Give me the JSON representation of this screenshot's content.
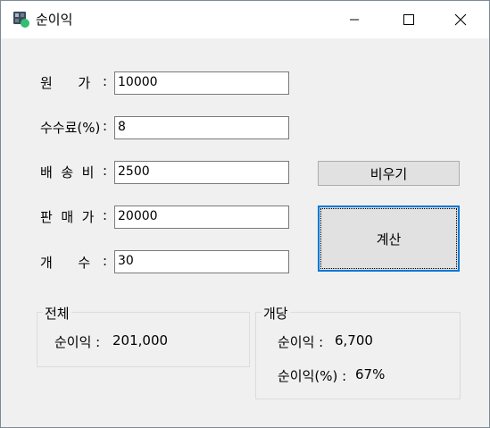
{
  "window": {
    "title": "순이익",
    "controls": {
      "minimize": "minimize-icon",
      "maximize": "maximize-icon",
      "close": "close-icon"
    }
  },
  "form": {
    "cost_label": "원      가",
    "fee_label": "수수료(%)",
    "shipping_label": "배  송  비",
    "price_label": "판  매  가",
    "count_label": "개      수",
    "colon": ":",
    "cost_value": "10000",
    "fee_value": "8",
    "shipping_value": "2500",
    "price_value": "20000",
    "count_value": "30"
  },
  "buttons": {
    "clear_label": "비우기",
    "calc_label": "계산"
  },
  "results": {
    "total_group_title": "전체",
    "total_profit_label": "순이익 :",
    "total_profit_value": "201,000",
    "each_group_title": "개당",
    "each_profit_label": "순이익 :",
    "each_profit_value": "6,700",
    "each_rate_label": "순이익(%) :",
    "each_rate_value": "67%"
  },
  "colors": {
    "accent": "#0078d7",
    "window_bg": "#f0f0f0",
    "button_bg": "#e1e1e1"
  }
}
